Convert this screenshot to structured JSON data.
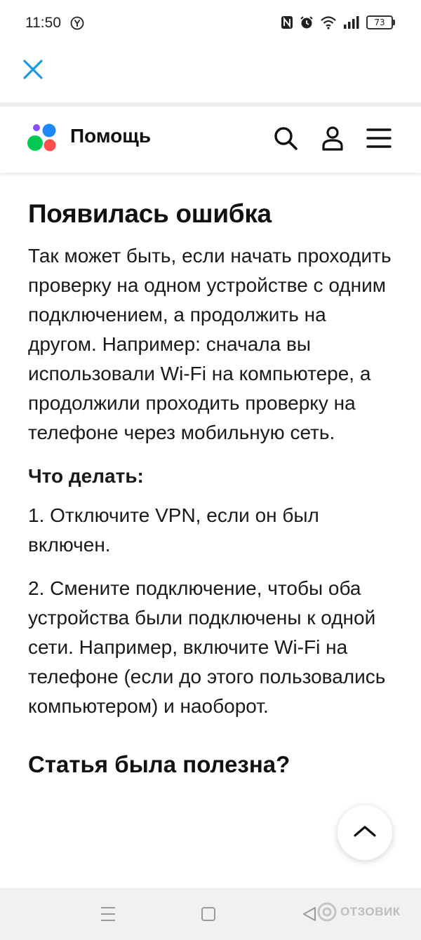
{
  "status_bar": {
    "time": "11:50",
    "battery": "73",
    "icons": [
      "yandex-icon",
      "nfc-icon",
      "alarm-icon",
      "wifi-icon",
      "signal-icon",
      "battery-icon"
    ]
  },
  "header": {
    "brand": "Помощь",
    "logo_colors": [
      "#8a4dff",
      "#1e88ff",
      "#00c853",
      "#ff4d4d"
    ]
  },
  "article": {
    "title": "Появилась ошибка",
    "intro": "Так может быть, если начать проходить проверку на одном устройстве с одним подключением, а продолжить на другом. Например: сначала вы использовали Wi-Fi на компьютере, а продолжили проходить проверку на телефоне через мобильную сеть.",
    "what_to_do": "Что делать:",
    "steps": [
      "1. Отключите VPN, если он был включен.",
      "2. Смените подключение, чтобы оба устройства были подключены к одной сети. Например, включите Wi-Fi на телефоне (если до этого пользовались компьютером) и наоборот."
    ],
    "feedback_question": "Статья была полезна?"
  },
  "watermark": "ОТЗОВИК",
  "colors": {
    "close_accent": "#1a9be0"
  }
}
